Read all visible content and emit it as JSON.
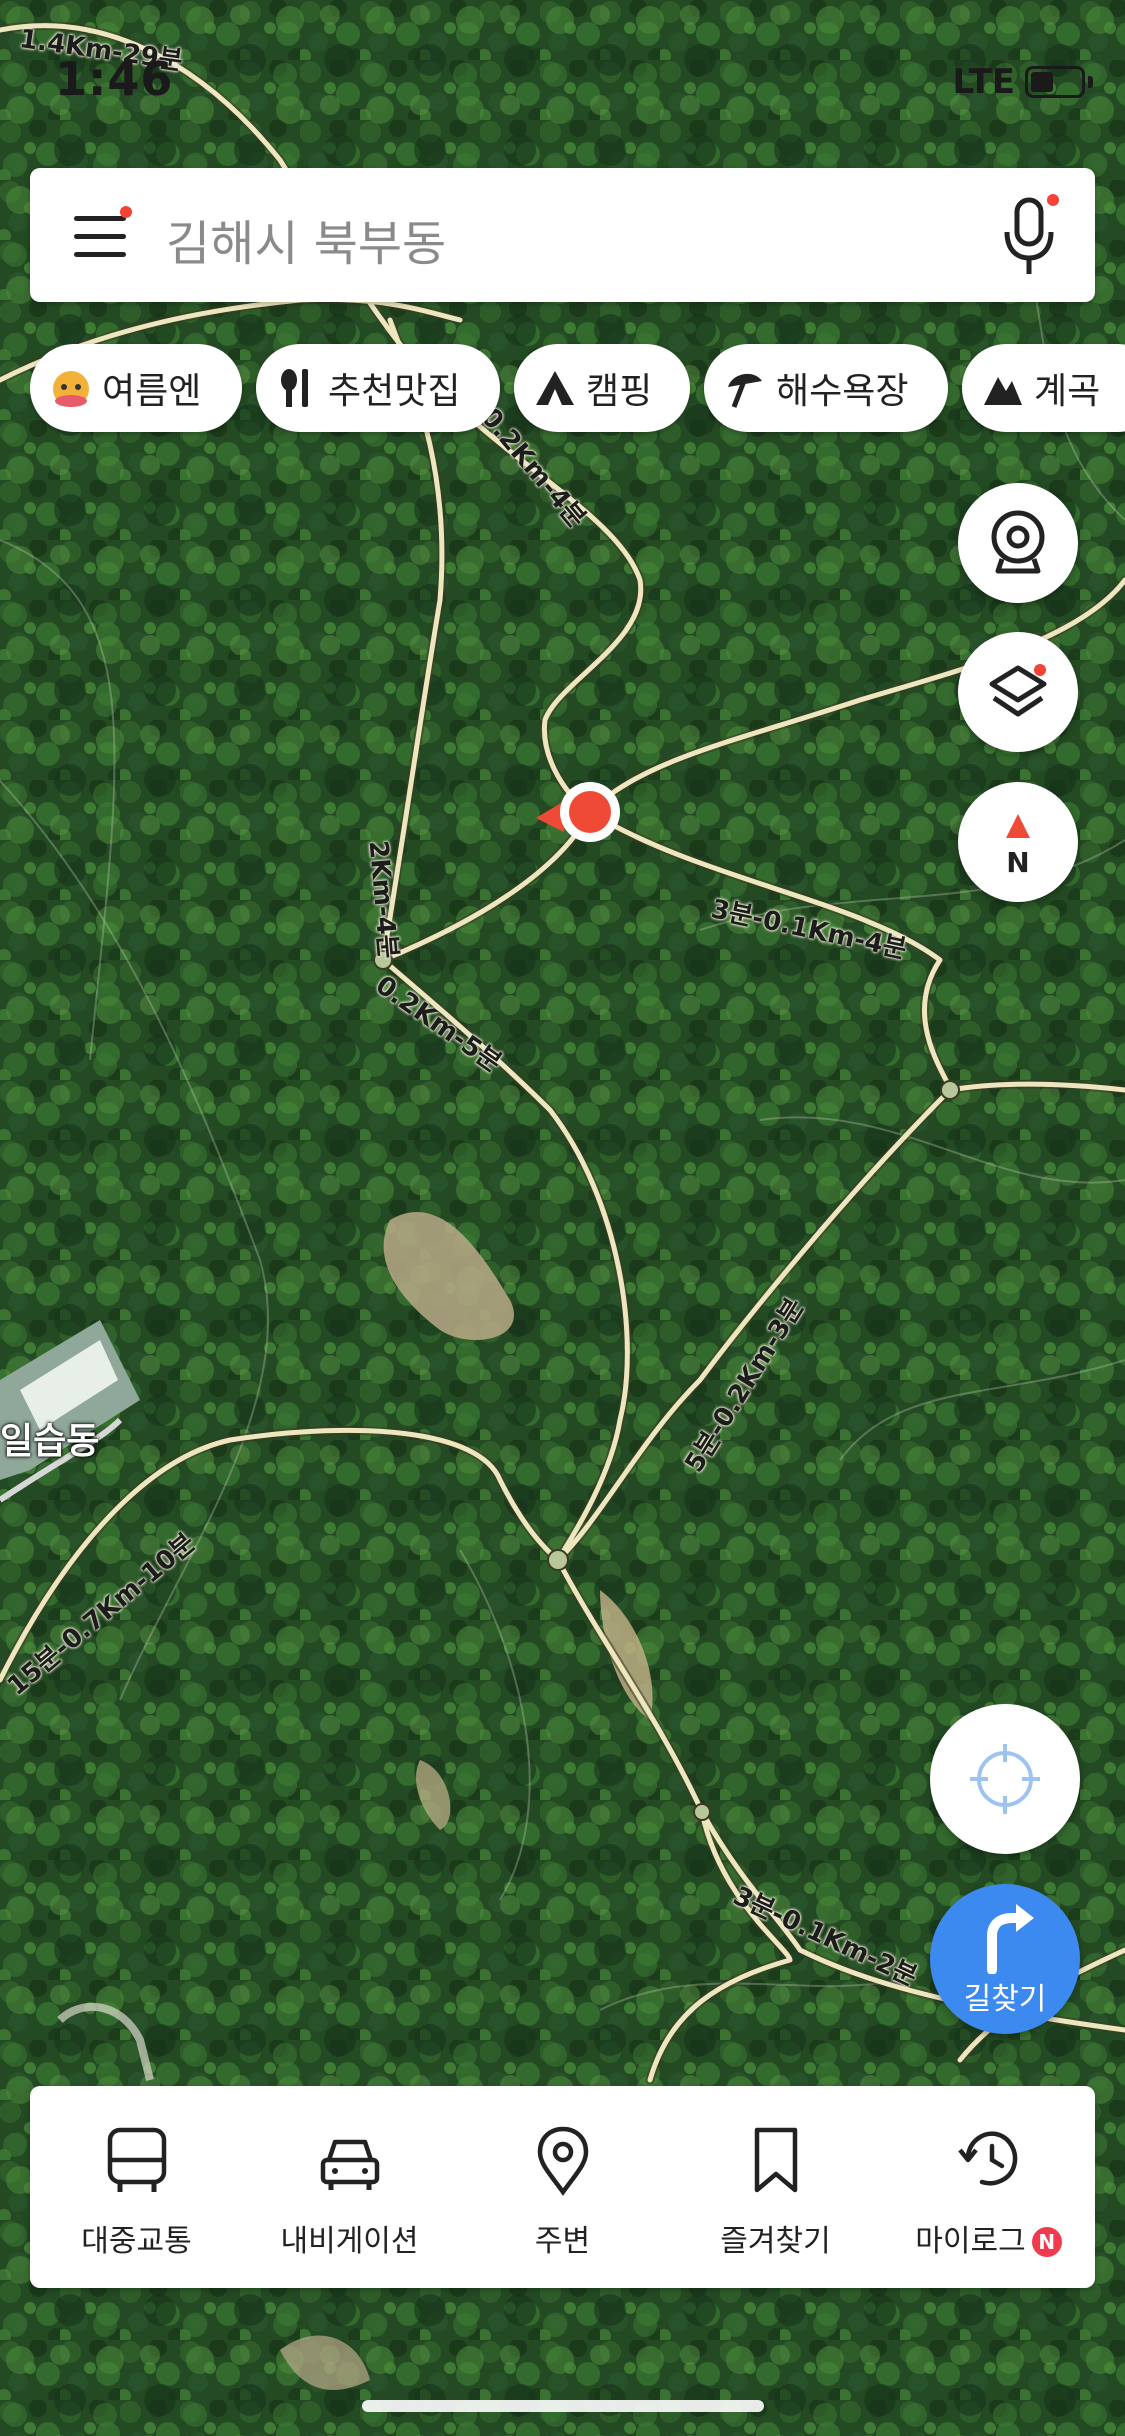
{
  "status_bar": {
    "time": "1:46",
    "network": "LTE"
  },
  "search": {
    "placeholder": "김해시 북부동"
  },
  "categories": [
    {
      "label": "여름엔",
      "icon": "character-icon"
    },
    {
      "label": "추천맛집",
      "icon": "restaurant-icon"
    },
    {
      "label": "캠핑",
      "icon": "tent-icon"
    },
    {
      "label": "해수욕장",
      "icon": "beach-umbrella-icon"
    },
    {
      "label": "계곡",
      "icon": "mountain-icon"
    }
  ],
  "map": {
    "place_labels": [
      "일습동"
    ],
    "trail_labels": [
      "1.4Km-29분",
      "0.2Km-4분",
      "3분-0.1Km-4분",
      "2Km-4분",
      "0.2Km-5분",
      "5분-0.2Km-3분",
      "15분-0.7Km-10분",
      "3분-0.1Km-2분"
    ],
    "colors": {
      "trail": "#ede6bf",
      "marker": "#ef4a35",
      "accent": "#3c8af0"
    }
  },
  "controls": {
    "cctv": "cctv-icon",
    "layers": "layers-icon",
    "compass": "N",
    "locate": "crosshair-icon",
    "route_label": "길찾기"
  },
  "bottom_tabs": [
    {
      "label": "대중교통",
      "icon": "bus-icon"
    },
    {
      "label": "내비게이션",
      "icon": "car-icon"
    },
    {
      "label": "주변",
      "icon": "location-pin-icon"
    },
    {
      "label": "즐겨찾기",
      "icon": "bookmark-icon"
    },
    {
      "label": "마이로그",
      "icon": "history-icon",
      "badge": "N"
    }
  ]
}
